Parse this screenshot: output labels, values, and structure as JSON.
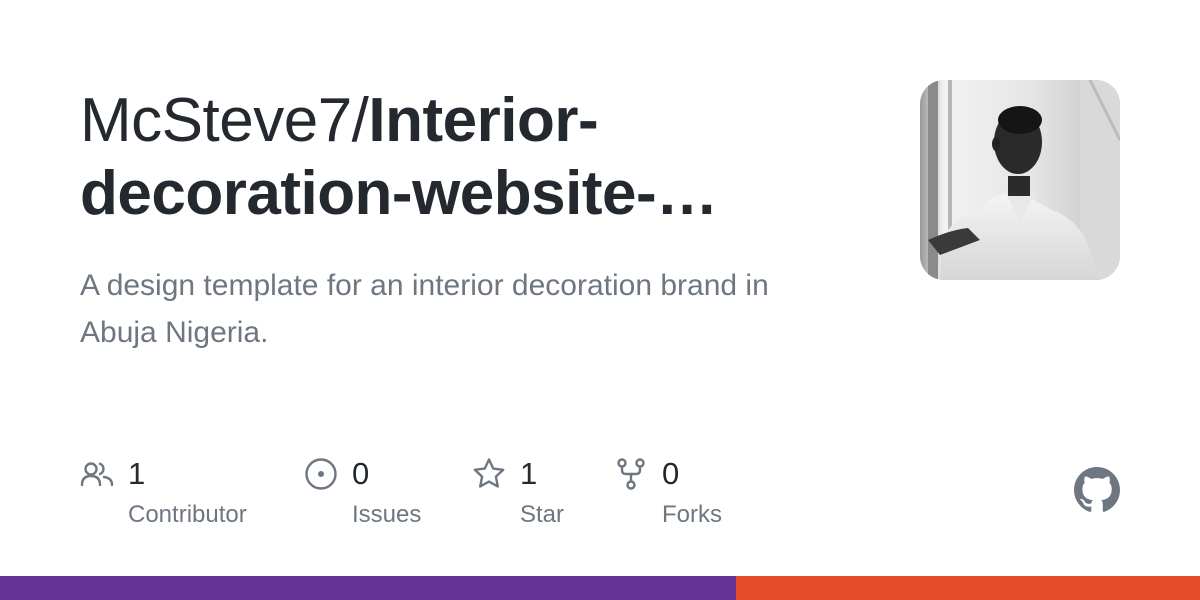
{
  "repo": {
    "owner": "McSteve7/",
    "name": "Interior-decoration-website-…",
    "description": "A design template for an interior decoration brand in Abuja Nigeria."
  },
  "stats": {
    "contributors": {
      "count": "1",
      "label": "Contributor",
      "icon": "people-icon"
    },
    "issues": {
      "count": "0",
      "label": "Issues",
      "icon": "issue-opened-icon"
    },
    "stars": {
      "count": "1",
      "label": "Star",
      "icon": "star-icon"
    },
    "forks": {
      "count": "0",
      "label": "Forks",
      "icon": "repo-forked-icon"
    }
  },
  "colors": {
    "title": "#24292f",
    "muted": "#6e7781",
    "icon": "#6e7781",
    "github_logo": "#6e7781"
  },
  "languages": [
    {
      "color": "#663399",
      "fraction": 0.613
    },
    {
      "color": "#e34c26",
      "fraction": 0.387
    }
  ]
}
